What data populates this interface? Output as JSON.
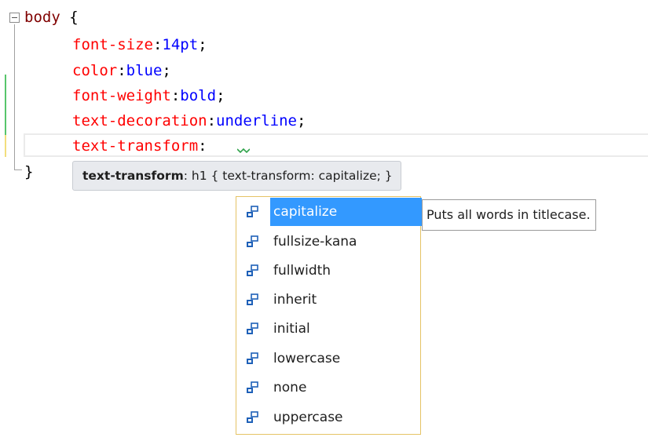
{
  "editor": {
    "selector": "body",
    "open_brace": "{",
    "close_brace": "}",
    "declarations": [
      {
        "property": "font-size",
        "value": "14pt"
      },
      {
        "property": "color",
        "value": "blue"
      },
      {
        "property": "font-weight",
        "value": "bold"
      },
      {
        "property": "text-decoration",
        "value": "underline"
      },
      {
        "property": "text-transform",
        "value": ""
      }
    ],
    "colon": ":",
    "semicolon": ";"
  },
  "quick_info": {
    "property": "text-transform",
    "separator": ":",
    "example": "h1 { text-transform: capitalize; }"
  },
  "completion": {
    "items": [
      {
        "label": "capitalize",
        "selected": true
      },
      {
        "label": "fullsize-kana",
        "selected": false
      },
      {
        "label": "fullwidth",
        "selected": false
      },
      {
        "label": "inherit",
        "selected": false
      },
      {
        "label": "initial",
        "selected": false
      },
      {
        "label": "lowercase",
        "selected": false
      },
      {
        "label": "none",
        "selected": false
      },
      {
        "label": "uppercase",
        "selected": false
      }
    ],
    "icon": "property-value-icon"
  },
  "description": "Puts all words in titlecase.",
  "colors": {
    "selector": "#800000",
    "property": "#ff0000",
    "value": "#0000ff",
    "selection": "#3399ff",
    "completion_border": "#e5c365",
    "squiggle": "#2fa24a",
    "changed_saved": "#57c56b",
    "changed_unsaved": "#f2de7c"
  }
}
